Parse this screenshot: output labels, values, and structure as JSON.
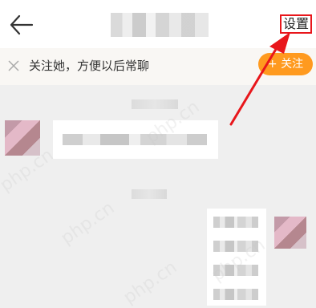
{
  "header": {
    "back_icon": "back-arrow-icon",
    "settings_label": "设置"
  },
  "follow_bar": {
    "close_icon": "close-icon",
    "text": "关注她，方便以后常聊",
    "button_label": "+ 关注"
  },
  "watermark": "php.cn",
  "colors": {
    "annotation_red": "#e8161b",
    "follow_orange": "#ff9a1f"
  }
}
